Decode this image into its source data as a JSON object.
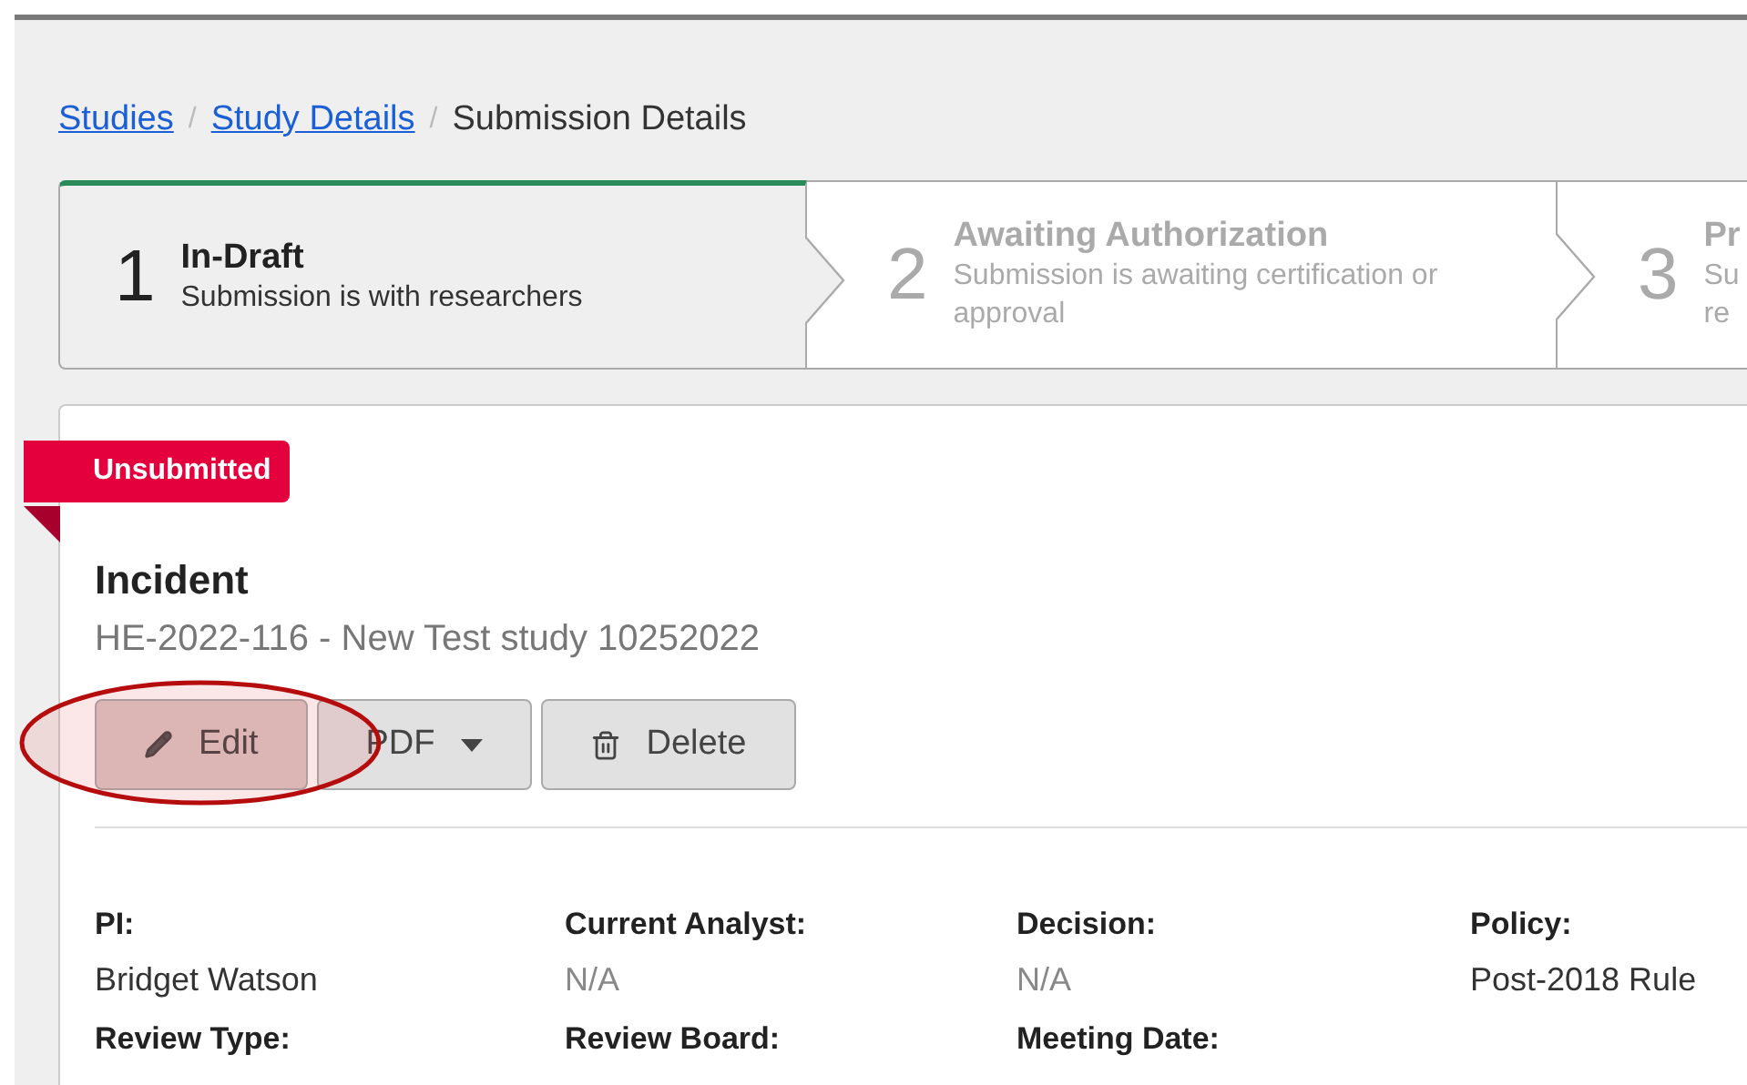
{
  "breadcrumb": [
    {
      "kind": "link",
      "label": "Studies"
    },
    {
      "kind": "separator",
      "label": "/"
    },
    {
      "kind": "link",
      "label": "Study Details"
    },
    {
      "kind": "separator",
      "label": "/"
    },
    {
      "kind": "current",
      "label": "Submission Details"
    }
  ],
  "steps": [
    {
      "number": "1",
      "title": "In-Draft",
      "description_lines": [
        "Submission is with researchers"
      ],
      "selected": true
    },
    {
      "number": "2",
      "title": "Awaiting Authorization",
      "description_lines": [
        "Submission is awaiting certification or",
        "approval"
      ],
      "selected": false
    },
    {
      "number": "3",
      "title": "Pr",
      "description_lines": [
        "Su",
        "re"
      ],
      "selected": false
    }
  ],
  "status_ribbon": "Unsubmitted",
  "title": "Incident",
  "subtitle": "HE-2022-116 - New Test study 10252022",
  "buttons": [
    {
      "kind": "edit",
      "label": "Edit",
      "highlighted": true
    },
    {
      "kind": "pdf",
      "label": "PDF"
    },
    {
      "kind": "delete",
      "label": "Delete"
    }
  ],
  "details": [
    {
      "label": "PI:",
      "value": "Bridget Watson",
      "muted": false
    },
    {
      "label": "Current Analyst:",
      "value": "N/A",
      "muted": true
    },
    {
      "label": "Decision:",
      "value": "N/A",
      "muted": true
    },
    {
      "label": "Policy:",
      "value": "Post-2018 Rule",
      "muted": false
    },
    {
      "label": "Review Type:"
    },
    {
      "label": "Review Board:"
    },
    {
      "label": "Meeting Date:"
    }
  ]
}
